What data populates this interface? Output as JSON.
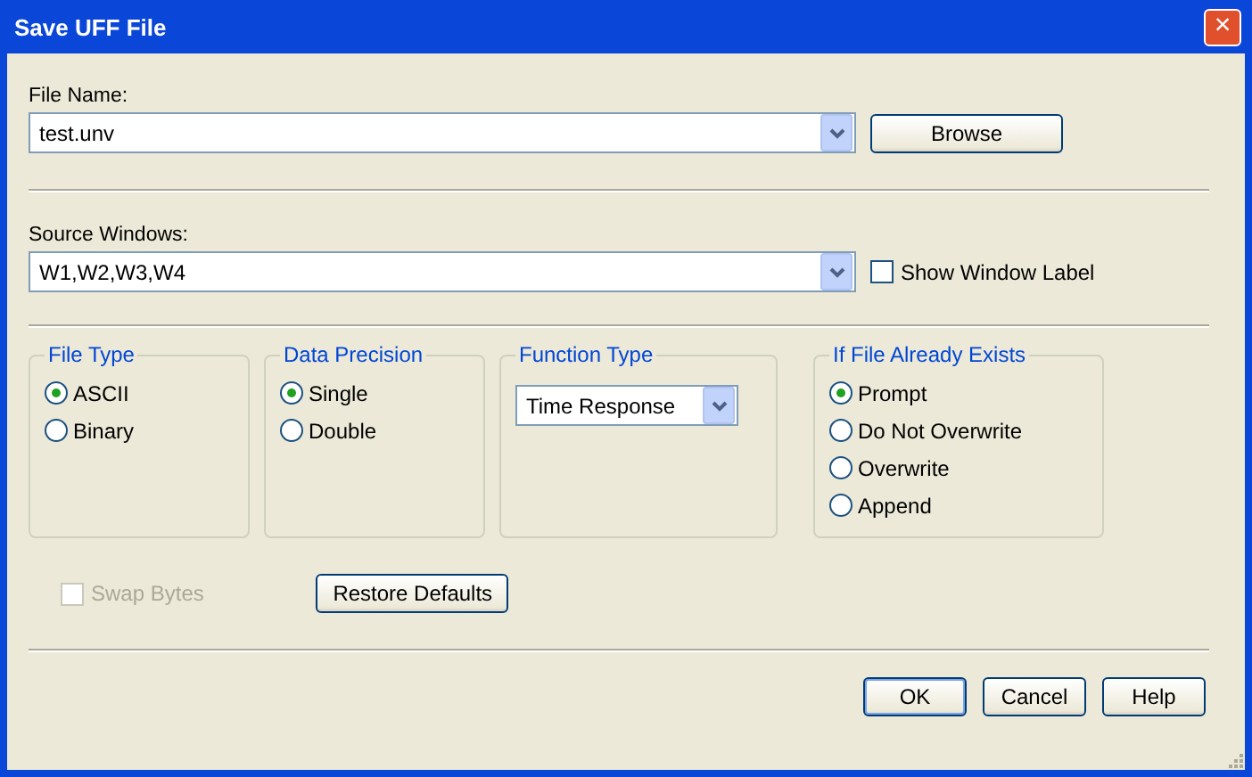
{
  "window": {
    "title": "Save UFF File",
    "close": "×"
  },
  "file_name": {
    "label": "File Name:",
    "value": "test.unv",
    "browse": "Browse"
  },
  "source_windows": {
    "label": "Source Windows:",
    "value": "W1,W2,W3,W4",
    "show_label": {
      "label": "Show Window Label",
      "checked": false
    }
  },
  "groups": [
    {
      "kind": "radio",
      "title": "File Type",
      "options": [
        {
          "label": "ASCII",
          "selected": true
        },
        {
          "label": "Binary",
          "selected": false
        }
      ]
    },
    {
      "kind": "radio",
      "title": "Data Precision",
      "options": [
        {
          "label": "Single",
          "selected": true
        },
        {
          "label": "Double",
          "selected": false
        }
      ]
    },
    {
      "kind": "dropdown",
      "title": "Function Type",
      "value": "Time Response"
    },
    {
      "kind": "radio",
      "title": "If File Already Exists",
      "options": [
        {
          "label": "Prompt",
          "selected": true
        },
        {
          "label": "Do Not Overwrite",
          "selected": false
        },
        {
          "label": "Overwrite",
          "selected": false
        },
        {
          "label": "Append",
          "selected": false
        }
      ]
    }
  ],
  "swap_bytes": {
    "label": "Swap Bytes",
    "checked": false,
    "disabled": true
  },
  "restore_defaults": "Restore Defaults",
  "buttons": [
    {
      "label": "OK",
      "default": true
    },
    {
      "label": "Cancel",
      "default": false
    },
    {
      "label": "Help",
      "default": false
    }
  ]
}
